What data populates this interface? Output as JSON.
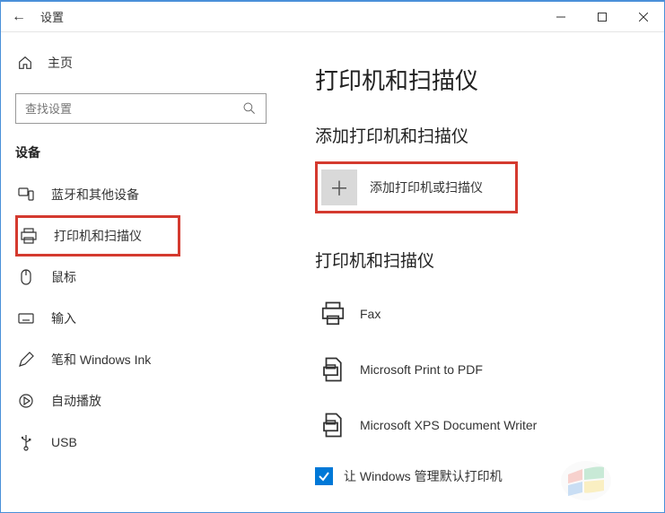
{
  "titlebar": {
    "back_glyph": "←",
    "title": "设置"
  },
  "sidebar": {
    "home": "主页",
    "search_placeholder": "查找设置",
    "section": "设备",
    "items": [
      {
        "label": "蓝牙和其他设备"
      },
      {
        "label": "打印机和扫描仪"
      },
      {
        "label": "鼠标"
      },
      {
        "label": "输入"
      },
      {
        "label": "笔和 Windows Ink"
      },
      {
        "label": "自动播放"
      },
      {
        "label": "USB"
      }
    ]
  },
  "main": {
    "heading": "打印机和扫描仪",
    "add_section_title": "添加打印机和扫描仪",
    "add_button": "添加打印机或扫描仪",
    "list_title": "打印机和扫描仪",
    "printers": [
      {
        "name": "Fax"
      },
      {
        "name": "Microsoft Print to PDF"
      },
      {
        "name": "Microsoft XPS Document Writer"
      }
    ],
    "default_checkbox": "让 Windows 管理默认打印机"
  }
}
